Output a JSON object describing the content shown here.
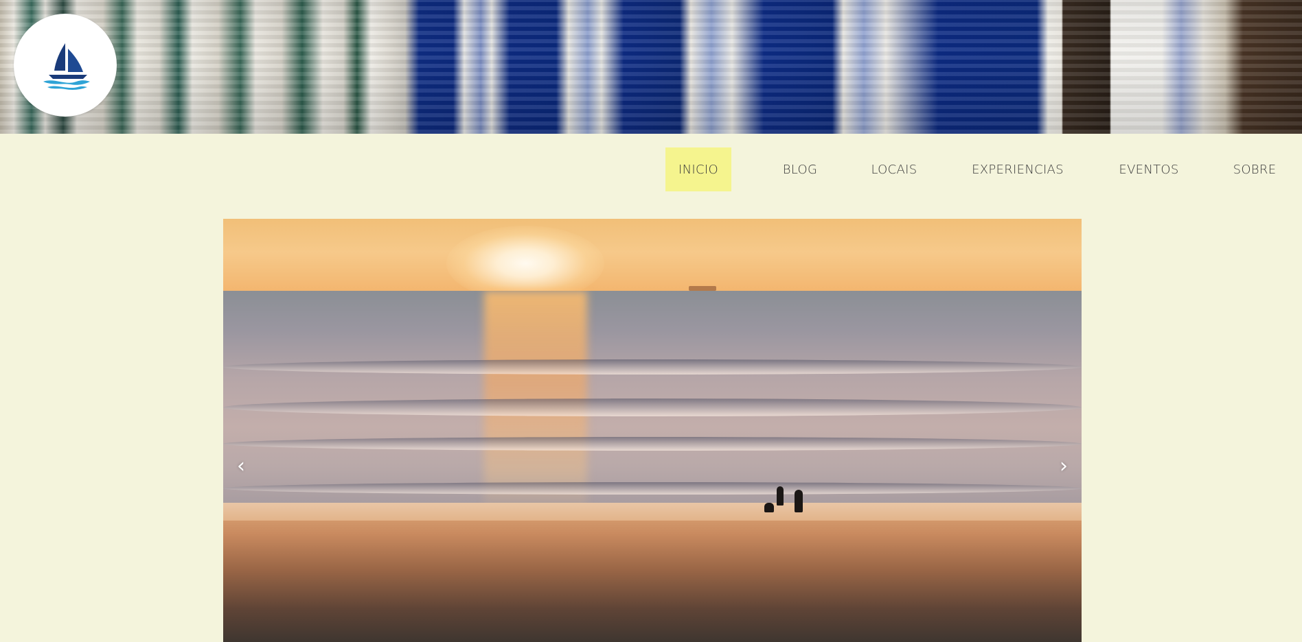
{
  "header": {
    "banner_image": "blue-doors-azulejo-tiles-banner",
    "logo": {
      "icon": "sailboat-icon",
      "colors": {
        "sail": "#1a3b7a",
        "water": "#2ea3d6"
      }
    }
  },
  "nav": {
    "active_color": "#f5f48e",
    "items": [
      {
        "label": "INICIO",
        "active": true
      },
      {
        "label": "BLOG",
        "active": false
      },
      {
        "label": "LOCAIS",
        "active": false
      },
      {
        "label": "EXPERIENCIAS",
        "active": false
      },
      {
        "label": "EVENTOS",
        "active": false
      },
      {
        "label": "SOBRE",
        "active": false
      }
    ]
  },
  "slider": {
    "image": "sunset-beach-people-photo",
    "prev_icon": "‹",
    "next_icon": "›"
  },
  "colors": {
    "page_background": "#f4f4dc"
  }
}
